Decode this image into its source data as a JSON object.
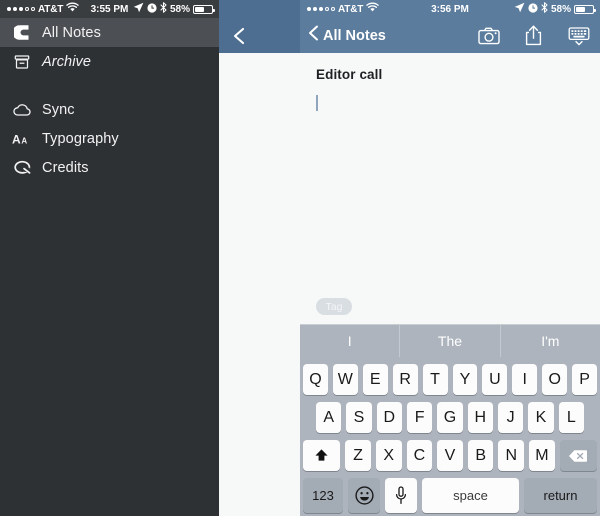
{
  "left": {
    "statusbar": {
      "carrier": "AT&T",
      "time": "3:55 PM",
      "battery_pct": "58%",
      "signal_dots_filled": 3,
      "signal_dots_total": 5,
      "icons": [
        "wifi-icon",
        "location-arrow-icon",
        "alarm-clock-icon",
        "bluetooth-icon",
        "battery-icon"
      ]
    },
    "menu": {
      "items": [
        {
          "label": "All Notes",
          "icon": "app-logo-icon",
          "active": true,
          "italic": false
        },
        {
          "label": "Archive",
          "icon": "archive-box-icon",
          "active": false,
          "italic": true
        },
        {
          "label": "Sync",
          "icon": "cloud-icon",
          "active": false,
          "italic": false
        },
        {
          "label": "Typography",
          "icon": "typography-aa-icon",
          "active": false,
          "italic": false
        },
        {
          "label": "Credits",
          "icon": "credits-q-icon",
          "active": false,
          "italic": false
        }
      ]
    },
    "peek": {
      "back_icon": "chevron-left-icon"
    }
  },
  "right": {
    "statusbar": {
      "carrier": "AT&T",
      "time": "3:56 PM",
      "battery_pct": "58%",
      "signal_dots_filled": 3,
      "signal_dots_total": 5
    },
    "navbar": {
      "back_label": "All Notes",
      "back_icon": "chevron-left-icon",
      "actions": [
        {
          "name": "camera-icon",
          "label": "Camera"
        },
        {
          "name": "share-icon",
          "label": "Share"
        },
        {
          "name": "keyboard-dismiss-icon",
          "label": "Dismiss Keyboard"
        }
      ]
    },
    "note": {
      "title": "Editor call",
      "body": "",
      "tag_label": "Tag"
    }
  },
  "keyboard": {
    "predictions": [
      "I",
      "The",
      "I'm"
    ],
    "row1": [
      "Q",
      "W",
      "E",
      "R",
      "T",
      "Y",
      "U",
      "I",
      "O",
      "P"
    ],
    "row2": [
      "A",
      "S",
      "D",
      "F",
      "G",
      "H",
      "J",
      "K",
      "L"
    ],
    "row3": [
      "Z",
      "X",
      "C",
      "V",
      "B",
      "N",
      "M"
    ],
    "shift_icon": "shift-arrow-icon",
    "delete_icon": "backspace-icon",
    "numeric_label": "123",
    "emoji_icon": "emoji-smiley-icon",
    "mic_icon": "microphone-icon",
    "space_label": "space",
    "return_label": "return"
  },
  "colors": {
    "navbar_blue": "#5b7c9d",
    "drawer_dark": "#2e3134",
    "drawer_active": "#4c4f54",
    "keyboard_bg": "#adb4bd",
    "editor_bg": "#f7f8f8",
    "tag_pill": "#d9dee3"
  }
}
